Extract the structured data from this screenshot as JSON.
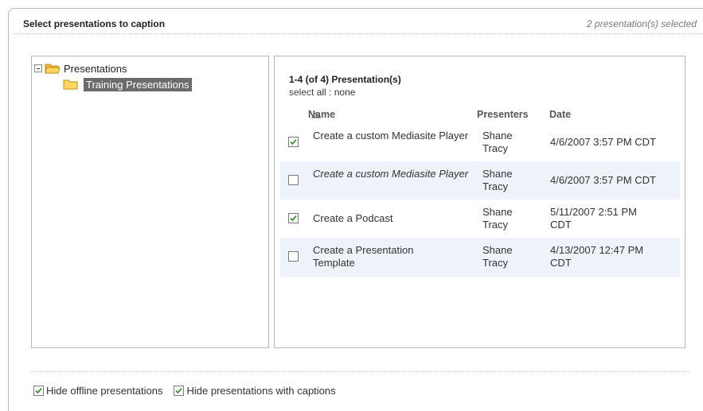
{
  "header": {
    "title": "Select presentations to caption",
    "selected_count": "2 presentation(s) selected"
  },
  "tree": {
    "root_label": "Presentations",
    "child_label": "Training Presentations"
  },
  "list": {
    "range_text": "1-4 (of 4) Presentation(s)",
    "select_prefix": "select ",
    "select_all": "all",
    "select_sep": " : ",
    "select_none": "none",
    "columns": {
      "name": "Name",
      "presenters": "Presenters",
      "date": "Date"
    },
    "sort_icon": "sort-ascending-icon",
    "rows": [
      {
        "checked": true,
        "name": "Create a custom Mediasite Player",
        "presenters": "Shane Tracy",
        "date": "4/6/2007 3:57 PM CDT"
      },
      {
        "checked": false,
        "name": "Create a custom Mediasite Player",
        "presenters": "Shane Tracy",
        "date": "4/6/2007 3:57 PM CDT",
        "italic": true
      },
      {
        "checked": true,
        "name": "Create a Podcast",
        "presenters": "Shane Tracy",
        "date": "5/11/2007 2:51 PM CDT"
      },
      {
        "checked": false,
        "name": "Create a Presentation Template",
        "presenters": "Shane Tracy",
        "date": "4/13/2007 12:47 PM CDT"
      }
    ]
  },
  "footer": {
    "hide_offline": {
      "label": "Hide offline presentations",
      "checked": true
    },
    "hide_captioned": {
      "label": "Hide presentations with captions",
      "checked": true
    }
  },
  "colors": {
    "selected_tree_bg": "#6b6b6b",
    "alt_row_bg": "#eef3f9",
    "check_green": "#3a9a2a",
    "folder_yellow": "#f5c542"
  }
}
